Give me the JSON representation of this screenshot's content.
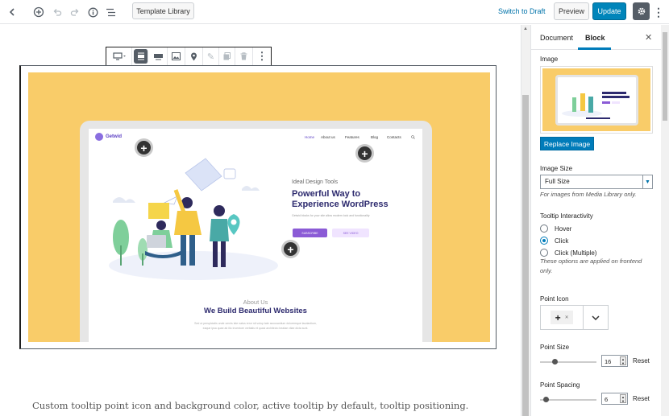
{
  "toolbar": {
    "template_library": "Template Library",
    "switch_to_draft": "Switch to Draft",
    "preview": "Preview",
    "update": "Update",
    "icons": [
      "back-icon",
      "add-block-icon",
      "undo-icon",
      "redo-icon",
      "info-icon",
      "outline-icon",
      "settings-icon",
      "more-icon"
    ]
  },
  "block_toolbar": {
    "items": [
      "block-type-icon",
      "align-wide-icon",
      "align-full-icon",
      "image-icon",
      "map-pin-icon",
      "edit-icon",
      "duplicate-icon",
      "trash-icon",
      "more-vertical-icon"
    ]
  },
  "mockup": {
    "logo": "Getwid",
    "nav": [
      "Home",
      "About us",
      "Features",
      "Blog",
      "Contacts"
    ],
    "subtitle": "Ideal Design Tools",
    "headline_1": "Powerful Way to",
    "headline_2": "Experience WordPress",
    "description": "Getwid blocks for your site allow modern look and functionality",
    "btn_subscribe": "SUBSCRIBE",
    "btn_video": "SEE VIDEO",
    "about_label": "About Us",
    "about_title": "We Build Beautiful Websites",
    "about_text_1": "Sed ut perspiciatis unde omnis iste natus error sit volup tate accusantium doloremque laudantium,",
    "about_text_2": "eaque ipsa quae ab illo inventore veritatis et quasi architecto beatae vitae dicta sunt."
  },
  "caption": "Custom tooltip point icon and background color, active tooltip by default, tooltip positioning.",
  "sidebar": {
    "tab_document": "Document",
    "tab_block": "Block",
    "close": "✕",
    "image_label": "Image",
    "replace_image": "Replace Image",
    "image_size_label": "Image Size",
    "image_size_value": "Full Size",
    "image_size_help": "For images from Media Library only.",
    "tooltip_label": "Tooltip Interactivity",
    "radio_options": [
      "Hover",
      "Click",
      "Click (Multiple)"
    ],
    "radio_selected": "Click",
    "radio_help": "These options are applied on frontend only.",
    "point_icon_label": "Point Icon",
    "point_icon_value": "+",
    "point_size_label": "Point Size",
    "point_size_value": "16",
    "point_spacing_label": "Point Spacing",
    "point_spacing_value": "6",
    "reset": "Reset"
  },
  "colors": {
    "accent": "#007cba",
    "update": "#0085ba",
    "mockup_bg": "#f9cc69",
    "headline": "#2d2a6e",
    "brand_purple": "#8b5bd6"
  }
}
